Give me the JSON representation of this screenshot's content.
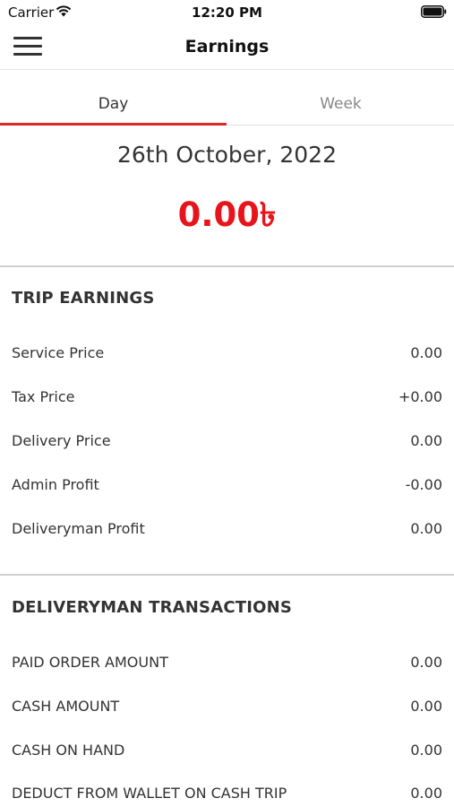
{
  "status_bar": {
    "carrier": "Carrier",
    "time": "12:20 PM"
  },
  "header": {
    "title": "Earnings"
  },
  "tabs": [
    {
      "label": "Day",
      "selected": true
    },
    {
      "label": "Week",
      "selected": false
    }
  ],
  "summary": {
    "date": "26th October, 2022",
    "amount": "0.00৳",
    "amount_color": "#e8141b"
  },
  "trip_earnings": {
    "title": "TRIP EARNINGS",
    "rows": [
      {
        "label": "Service Price",
        "value": "0.00"
      },
      {
        "label": "Tax Price",
        "value": "+0.00"
      },
      {
        "label": "Delivery Price",
        "value": "0.00"
      },
      {
        "label": "Admin Profit",
        "value": "-0.00"
      },
      {
        "label": "Deliveryman Profit",
        "value": "0.00"
      }
    ]
  },
  "deliveryman_transactions": {
    "title": "DELIVERYMAN TRANSACTIONS",
    "rows": [
      {
        "label": "PAID ORDER AMOUNT",
        "value": "0.00"
      },
      {
        "label": "CASH AMOUNT",
        "value": "0.00"
      },
      {
        "label": "CASH ON HAND",
        "value": "0.00"
      },
      {
        "label": "DEDUCT FROM WALLET ON CASH TRIP",
        "value": "0.00"
      }
    ]
  },
  "colors": {
    "accent": "#e0252b"
  }
}
